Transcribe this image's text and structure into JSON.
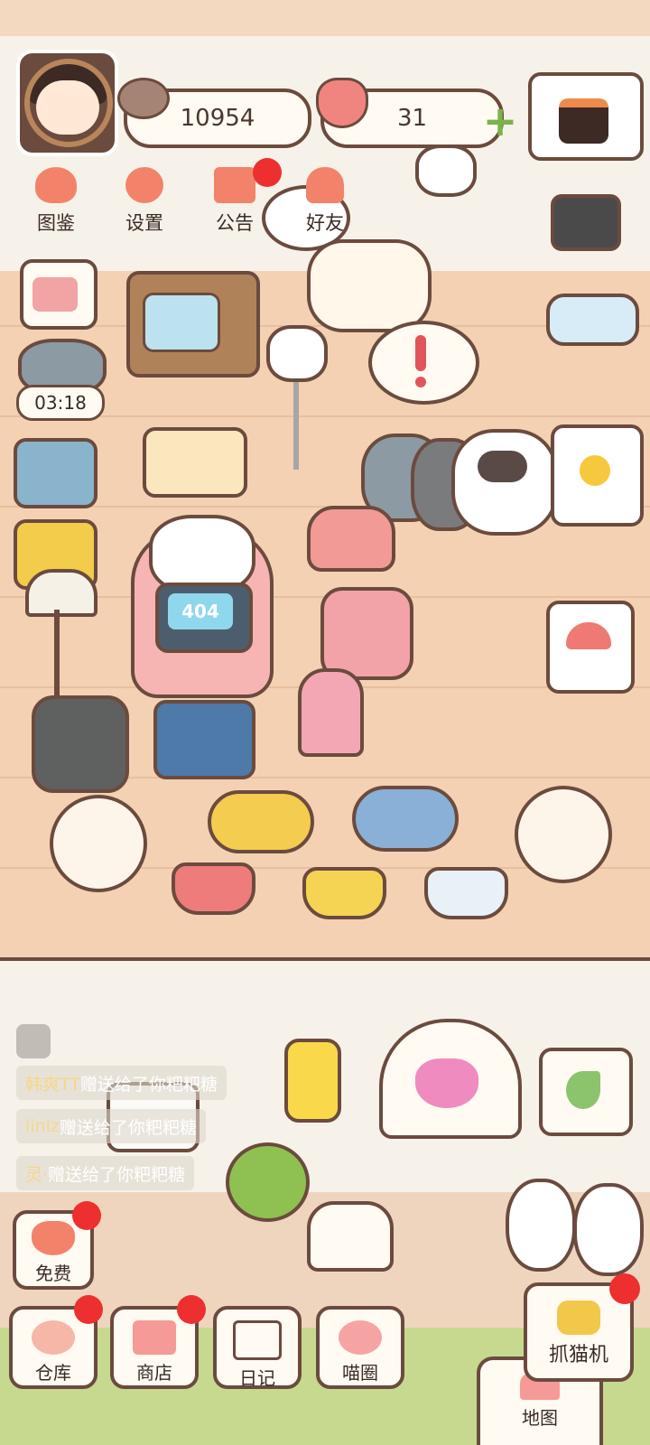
{
  "hud": {
    "fish_count": "10954",
    "heart_count": "31",
    "fish_icon": "fish-icon",
    "heart_icon": "heart-icon",
    "plus_icon": "plus-icon"
  },
  "menu": [
    {
      "label": "图鉴",
      "icon": "cat-book-icon"
    },
    {
      "label": "设置",
      "icon": "gear-icon"
    },
    {
      "label": "公告",
      "icon": "gift-icon"
    },
    {
      "label": "好友",
      "icon": "friends-icon"
    }
  ],
  "timer": "03:18",
  "screen_text": "404",
  "chat": [
    {
      "user": "韩爽TT",
      "text": "赠送给了你粑粑糖"
    },
    {
      "user": "linlz",
      "text": "赠送给了你粑粑糖"
    },
    {
      "user": "灵·",
      "text": "赠送给了你粑粑糖"
    }
  ],
  "bottom": {
    "free": "免费",
    "warehouse": "仓库",
    "shop": "商店",
    "diary": "日记",
    "circle": "喵圈",
    "claw": "抓猫机",
    "map": "地图"
  },
  "colors": {
    "outline": "#6b4b3e",
    "badge_red": "#ee2f2f",
    "floor": "#f3d1b2",
    "wall": "#f7f2e9",
    "accent_orange": "#f2836a"
  }
}
